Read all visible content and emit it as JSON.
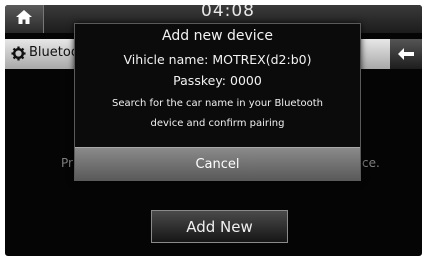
{
  "status_bar": {
    "clock": "04:08"
  },
  "header": {
    "title": "Bluetoo",
    "icons": {
      "home": "home-icon",
      "settings": "gear-icon",
      "back": "back-arrow-icon"
    }
  },
  "background": {
    "left_text": "Pr",
    "right_text": "ce.",
    "add_new_label": "Add New"
  },
  "dialog": {
    "title": "Add new device",
    "vehicle_name": "Vihicle name: MOTREX(d2:b0)",
    "passkey": "Passkey: 0000",
    "message_line1": "Search for the car name in your Bluetooth",
    "message_line2": "device and confirm pairing",
    "cancel_label": "Cancel"
  },
  "colors": {
    "screen_bg": "#050505",
    "title_bar": "#d0d0d0",
    "cancel_button": "#707070"
  }
}
